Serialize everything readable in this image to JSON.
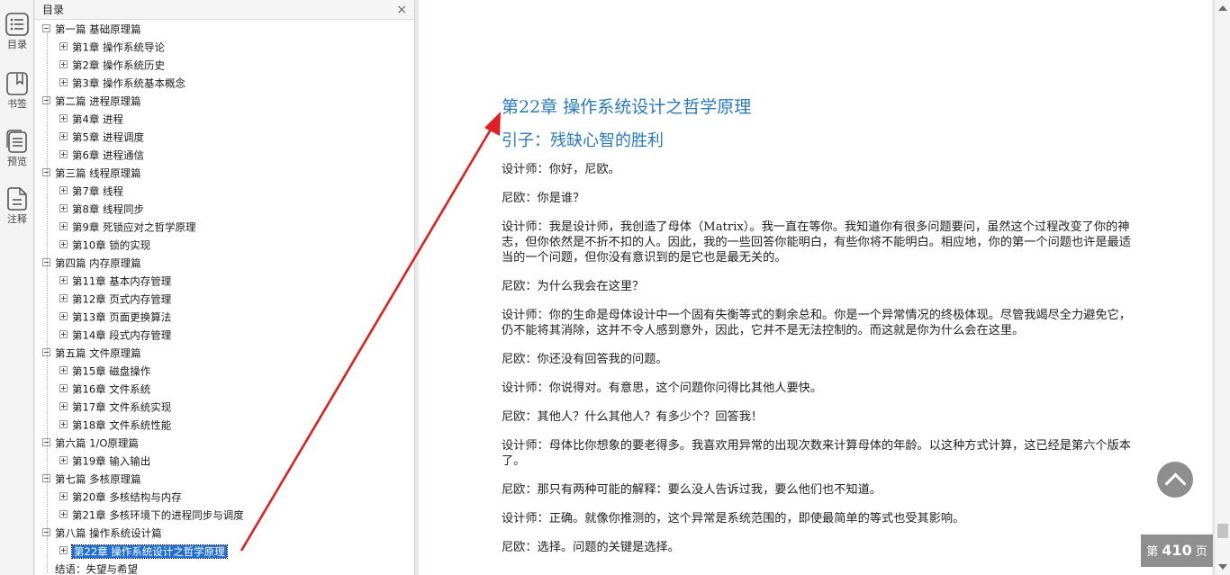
{
  "rail": {
    "toc_label": "目录",
    "bookmark_label": "书签",
    "preview_label": "预览",
    "annotation_label": "注释"
  },
  "toc": {
    "title": "目录",
    "close": "×",
    "items": [
      {
        "text": "第一篇  基础原理篇",
        "level": 0,
        "toggle": "minus"
      },
      {
        "text": "第1章  操作系统导论",
        "level": 1,
        "toggle": "plus"
      },
      {
        "text": "第2章  操作系统历史",
        "level": 1,
        "toggle": "plus"
      },
      {
        "text": "第3章  操作系统基本概念",
        "level": 1,
        "toggle": "plus"
      },
      {
        "text": "第二篇  进程原理篇",
        "level": 0,
        "toggle": "minus"
      },
      {
        "text": "第4章  进程",
        "level": 1,
        "toggle": "plus"
      },
      {
        "text": "第5章  进程调度",
        "level": 1,
        "toggle": "plus"
      },
      {
        "text": "第6章  进程通信",
        "level": 1,
        "toggle": "plus"
      },
      {
        "text": "第三篇  线程原理篇",
        "level": 0,
        "toggle": "minus"
      },
      {
        "text": "第7章  线程",
        "level": 1,
        "toggle": "plus"
      },
      {
        "text": "第8章  线程同步",
        "level": 1,
        "toggle": "plus"
      },
      {
        "text": "第9章  死锁应对之哲学原理",
        "level": 1,
        "toggle": "plus"
      },
      {
        "text": "第10章  锁的实现",
        "level": 1,
        "toggle": "plus"
      },
      {
        "text": "第四篇  内存原理篇",
        "level": 0,
        "toggle": "minus"
      },
      {
        "text": "第11章  基本内存管理",
        "level": 1,
        "toggle": "plus"
      },
      {
        "text": "第12章  页式内存管理",
        "level": 1,
        "toggle": "plus"
      },
      {
        "text": "第13章  页面更换算法",
        "level": 1,
        "toggle": "plus"
      },
      {
        "text": "第14章  段式内存管理",
        "level": 1,
        "toggle": "plus"
      },
      {
        "text": "第五篇  文件原理篇",
        "level": 0,
        "toggle": "minus"
      },
      {
        "text": "第15章  磁盘操作",
        "level": 1,
        "toggle": "plus"
      },
      {
        "text": "第16章  文件系统",
        "level": 1,
        "toggle": "plus"
      },
      {
        "text": "第17章  文件系统实现",
        "level": 1,
        "toggle": "plus"
      },
      {
        "text": "第18章  文件系统性能",
        "level": 1,
        "toggle": "plus"
      },
      {
        "text": "第六篇  1/O原理篇",
        "level": 0,
        "toggle": "minus"
      },
      {
        "text": "第19章  输入输出",
        "level": 1,
        "toggle": "plus"
      },
      {
        "text": "第七篇  多核原理篇",
        "level": 0,
        "toggle": "minus"
      },
      {
        "text": "第20章  多核结构与内存",
        "level": 1,
        "toggle": "plus"
      },
      {
        "text": "第21章  多核环境下的进程同步与调度",
        "level": 1,
        "toggle": "plus"
      },
      {
        "text": "第八篇  操作系统设计篇",
        "level": 0,
        "toggle": "minus"
      },
      {
        "text": "第22章  操作系统设计之哲学原理",
        "level": 1,
        "toggle": "plus",
        "selected": true
      },
      {
        "text": "结语：失望与希望",
        "level": 0,
        "toggle": "none"
      }
    ]
  },
  "doc": {
    "chapter_title": "第22章    操作系统设计之哲学原理",
    "section_title": "引子：残缺心智的胜利",
    "paragraphs": [
      "设计师：你好，尼欧。",
      "尼欧：你是谁？",
      "设计师：我是设计师，我创造了母体（Matrix）。我一直在等你。我知道你有很多问题要问，虽然这个过程改变了你的神志，但你依然是不折不扣的人。因此，我的一些回答你能明白，有些你将不能明白。相应地，你的第一个问题也许是最适当的一个问题，但你没有意识到的是它也是最无关的。",
      "尼欧：为什么我会在这里？",
      "设计师：你的生命是母体设计中一个固有失衡等式的剩余总和。你是一个异常情况的终极体现。尽管我竭尽全力避免它，仍不能将其消除，这并不令人感到意外，因此，它并不是无法控制的。而这就是你为什么会在这里。",
      "尼欧：你还没有回答我的问题。",
      "设计师：你说得对。有意思，这个问题你问得比其他人要快。",
      "尼欧：其他人？什么其他人？有多少个？回答我！",
      "设计师：母体比你想象的要老得多。我喜欢用异常的出现次数来计算母体的年龄。以这种方式计算，这已经是第六个版本了。",
      "尼欧：那只有两种可能的解释：要么没人告诉过我，要么他们也不知道。",
      "设计师：正确。就像你推测的，这个异常是系统范围的，即使最简单的等式也受其影响。",
      "尼欧：选择。问题的关键是选择。"
    ]
  },
  "page_indicator": {
    "prefix": "第",
    "number": "410",
    "suffix": "页"
  },
  "colors": {
    "title_blue": "#2a7ab9",
    "annotation_red": "#e02020",
    "selection_blue": "#1f6fd6"
  }
}
